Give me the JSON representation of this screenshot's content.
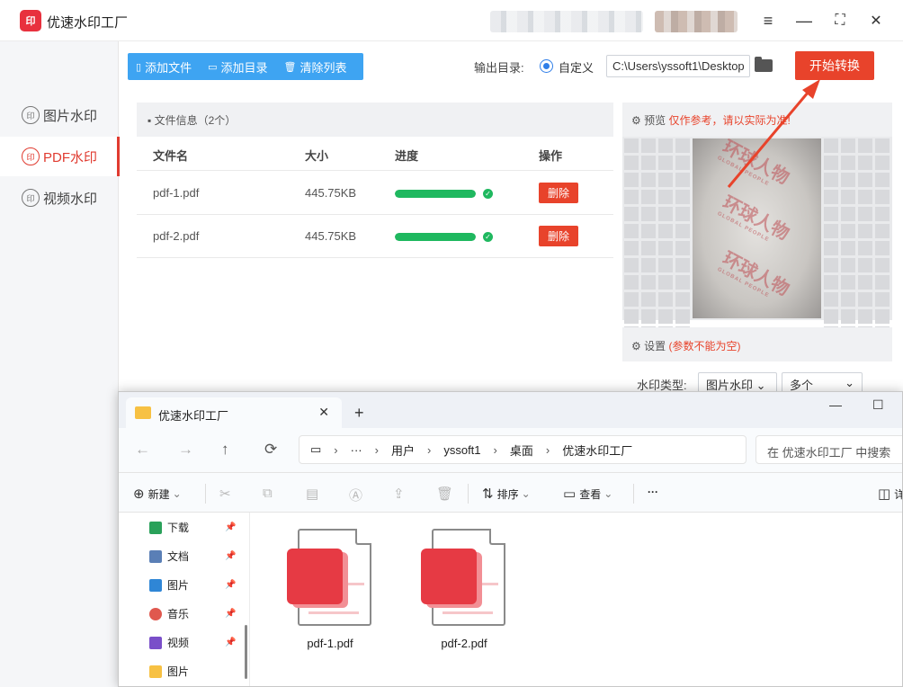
{
  "app": {
    "logo_text": "印",
    "title": "优速水印工厂",
    "window_buttons": {
      "menu": "≡",
      "minimize": "—",
      "maximize": "⛶",
      "close": "✕"
    }
  },
  "sidebar": {
    "items": [
      {
        "label": "图片水印",
        "icon": "印",
        "active": false
      },
      {
        "label": "PDF水印",
        "icon": "印",
        "active": true
      },
      {
        "label": "视频水印",
        "icon": "印",
        "active": false
      }
    ]
  },
  "toolbar": {
    "add_file": "添加文件",
    "add_dir": "添加目录",
    "clear_list": "清除列表",
    "add_file_icon": "▯",
    "add_dir_icon": "▭",
    "clear_icon": "🗑"
  },
  "output": {
    "label": "输出目录:",
    "option_label": "自定义",
    "path": "C:\\Users\\yssoft1\\Desktop"
  },
  "start_button": "开始转换",
  "file_panel": {
    "header": "文件信息（2个）",
    "columns": {
      "name": "文件名",
      "size": "大小",
      "progress": "进度",
      "action": "操作"
    },
    "rows": [
      {
        "name": "pdf-1.pdf",
        "size": "445.75KB",
        "progress": 100,
        "action": "删除"
      },
      {
        "name": "pdf-2.pdf",
        "size": "445.75KB",
        "progress": 100,
        "action": "删除"
      }
    ]
  },
  "preview": {
    "label": "预览",
    "warning": "仅作参考，请以实际为准!",
    "watermark_text": "环球人物",
    "watermark_sub": "GLOBAL PEOPLE"
  },
  "settings": {
    "label": "设置",
    "warning": "(参数不能为空)",
    "type_label": "水印类型:",
    "type_value": "图片水印",
    "count_value": "多个"
  },
  "explorer": {
    "tab_title": "优速水印工厂",
    "tab_close": "✕",
    "new_tab": "+",
    "window_buttons": {
      "minimize": "—",
      "maximize": "☐"
    },
    "nav": {
      "back": "←",
      "forward": "→",
      "up": "↑",
      "refresh": "⟳"
    },
    "breadcrumbs": [
      "用户",
      "yssoft1",
      "桌面",
      "优速水印工厂"
    ],
    "more_crumbs": "···",
    "search_placeholder": "在 优速水印工厂 中搜索",
    "commands": {
      "new": "新建",
      "sort": "排序",
      "view": "查看",
      "more": "···",
      "details": "详"
    },
    "sidebar": [
      {
        "label": "下载",
        "color": "#2aa15a"
      },
      {
        "label": "文档",
        "color": "#5a7fb6"
      },
      {
        "label": "图片",
        "color": "#2f86d6"
      },
      {
        "label": "音乐",
        "color": "#e0584e"
      },
      {
        "label": "视频",
        "color": "#7a4fc9"
      },
      {
        "label": "图片",
        "color": "#f7c143"
      }
    ],
    "files": [
      {
        "name": "pdf-1.pdf"
      },
      {
        "name": "pdf-2.pdf"
      }
    ]
  }
}
